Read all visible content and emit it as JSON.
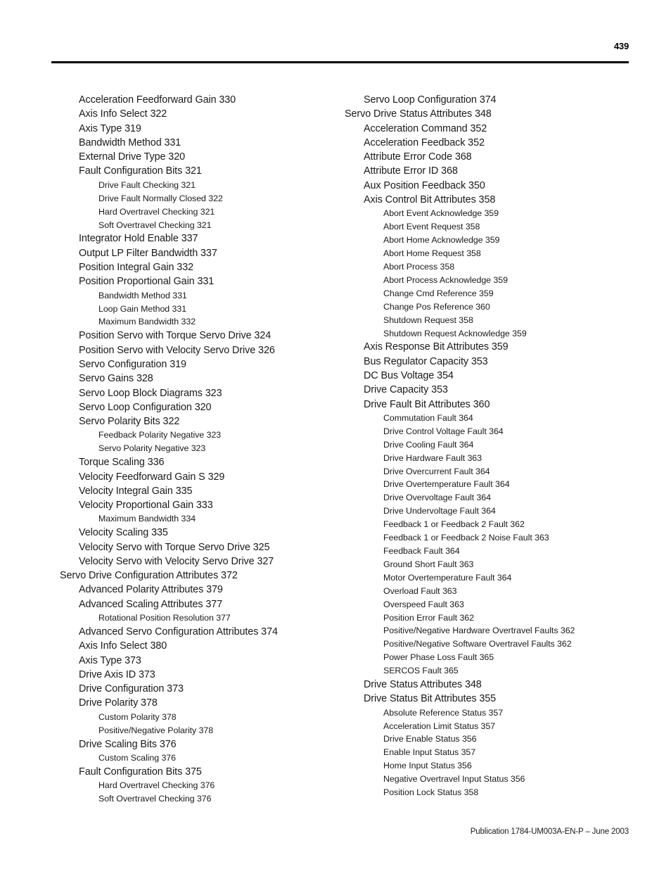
{
  "header": {
    "page_number": "439"
  },
  "footer": {
    "publication": "Publication 1784-UM003A-EN-P – June 2003"
  },
  "index": {
    "left_column": [
      {
        "level": 1,
        "text": "Acceleration Feedforward Gain 330"
      },
      {
        "level": 1,
        "text": "Axis Info Select 322"
      },
      {
        "level": 1,
        "text": "Axis Type 319"
      },
      {
        "level": 1,
        "text": "Bandwidth Method 331"
      },
      {
        "level": 1,
        "text": "External Drive Type 320"
      },
      {
        "level": 1,
        "text": "Fault Configuration Bits 321"
      },
      {
        "level": 2,
        "text": "Drive Fault Checking 321"
      },
      {
        "level": 2,
        "text": "Drive Fault Normally Closed 322"
      },
      {
        "level": 2,
        "text": "Hard Overtravel Checking 321"
      },
      {
        "level": 2,
        "text": "Soft Overtravel Checking 321"
      },
      {
        "level": 1,
        "text": "Integrator Hold Enable 337"
      },
      {
        "level": 1,
        "text": "Output LP Filter Bandwidth 337"
      },
      {
        "level": 1,
        "text": "Position Integral Gain 332"
      },
      {
        "level": 1,
        "text": "Position Proportional Gain 331"
      },
      {
        "level": 2,
        "text": "Bandwidth Method 331"
      },
      {
        "level": 2,
        "text": "Loop Gain Method 331"
      },
      {
        "level": 2,
        "text": "Maximum Bandwidth 332"
      },
      {
        "level": 1,
        "text": "Position Servo with Torque Servo Drive 324"
      },
      {
        "level": 1,
        "text": "Position Servo with Velocity Servo Drive 326"
      },
      {
        "level": 1,
        "text": "Servo Configuration 319"
      },
      {
        "level": 1,
        "text": "Servo Gains 328"
      },
      {
        "level": 1,
        "text": "Servo Loop Block Diagrams 323"
      },
      {
        "level": 1,
        "text": "Servo Loop Configuration 320"
      },
      {
        "level": 1,
        "text": "Servo Polarity Bits 322"
      },
      {
        "level": 2,
        "text": "Feedback Polarity Negative 323"
      },
      {
        "level": 2,
        "text": "Servo Polarity Negative 323"
      },
      {
        "level": 1,
        "text": "Torque Scaling 336"
      },
      {
        "level": 1,
        "text": "Velocity Feedforward Gain S 329"
      },
      {
        "level": 1,
        "text": "Velocity Integral Gain 335"
      },
      {
        "level": 1,
        "text": "Velocity Proportional Gain 333"
      },
      {
        "level": 2,
        "text": "Maximum Bandwidth 334"
      },
      {
        "level": 1,
        "text": "Velocity Scaling 335"
      },
      {
        "level": 1,
        "text": "Velocity Servo with Torque Servo Drive 325"
      },
      {
        "level": 1,
        "text": "Velocity Servo with Velocity Servo Drive 327"
      },
      {
        "level": 0,
        "text": "Servo Drive Configuration Attributes 372"
      },
      {
        "level": 1,
        "text": "Advanced Polarity Attributes 379"
      },
      {
        "level": 1,
        "text": "Advanced Scaling Attributes 377"
      },
      {
        "level": 2,
        "text": "Rotational Position Resolution 377"
      },
      {
        "level": 1,
        "text": "Advanced Servo Configuration Attributes 374"
      },
      {
        "level": 1,
        "text": "Axis Info Select 380"
      },
      {
        "level": 1,
        "text": "Axis Type 373"
      },
      {
        "level": 1,
        "text": "Drive Axis ID 373"
      },
      {
        "level": 1,
        "text": "Drive Configuration 373"
      },
      {
        "level": 1,
        "text": "Drive Polarity 378"
      },
      {
        "level": 2,
        "text": "Custom Polarity 378"
      },
      {
        "level": 2,
        "text": "Positive/Negative Polarity 378"
      },
      {
        "level": 1,
        "text": "Drive Scaling Bits 376"
      },
      {
        "level": 2,
        "text": "Custom Scaling 376"
      },
      {
        "level": 1,
        "text": "Fault Configuration Bits 375"
      },
      {
        "level": 2,
        "text": "Hard Overtravel Checking 376"
      },
      {
        "level": 2,
        "text": "Soft Overtravel Checking 376"
      }
    ],
    "right_column": [
      {
        "level": 1,
        "text": "Servo Loop Configuration 374"
      },
      {
        "level": 0,
        "text": "Servo Drive Status Attributes 348"
      },
      {
        "level": 1,
        "text": "Acceleration Command 352"
      },
      {
        "level": 1,
        "text": "Acceleration Feedback 352"
      },
      {
        "level": 1,
        "text": "Attribute Error Code 368"
      },
      {
        "level": 1,
        "text": "Attribute Error ID 368"
      },
      {
        "level": 1,
        "text": "Aux Position Feedback 350"
      },
      {
        "level": 1,
        "text": "Axis Control Bit Attributes 358"
      },
      {
        "level": 2,
        "text": "Abort Event Acknowledge 359"
      },
      {
        "level": 2,
        "text": "Abort Event Request 358"
      },
      {
        "level": 2,
        "text": "Abort Home Acknowledge 359"
      },
      {
        "level": 2,
        "text": "Abort Home Request 358"
      },
      {
        "level": 2,
        "text": "Abort Process 358"
      },
      {
        "level": 2,
        "text": "Abort Process Acknowledge 359"
      },
      {
        "level": 2,
        "text": "Change Cmd Reference 359"
      },
      {
        "level": 2,
        "text": "Change Pos Reference 360"
      },
      {
        "level": 2,
        "text": "Shutdown Request 358"
      },
      {
        "level": 2,
        "text": "Shutdown Request Acknowledge 359"
      },
      {
        "level": 1,
        "text": "Axis Response Bit Attributes 359"
      },
      {
        "level": 1,
        "text": "Bus Regulator Capacity 353"
      },
      {
        "level": 1,
        "text": "DC Bus Voltage 354"
      },
      {
        "level": 1,
        "text": "Drive Capacity 353"
      },
      {
        "level": 1,
        "text": "Drive Fault Bit Attributes 360"
      },
      {
        "level": 2,
        "text": "Commutation Fault 364"
      },
      {
        "level": 2,
        "text": "Drive Control Voltage Fault 364"
      },
      {
        "level": 2,
        "text": "Drive Cooling Fault 364"
      },
      {
        "level": 2,
        "text": "Drive Hardware Fault 363"
      },
      {
        "level": 2,
        "text": "Drive Overcurrent Fault 364"
      },
      {
        "level": 2,
        "text": "Drive Overtemperature Fault 364"
      },
      {
        "level": 2,
        "text": "Drive Overvoltage Fault 364"
      },
      {
        "level": 2,
        "text": "Drive Undervoltage Fault 364"
      },
      {
        "level": 2,
        "text": "Feedback 1 or Feedback 2 Fault 362"
      },
      {
        "level": 2,
        "text": "Feedback 1 or Feedback 2 Noise Fault 363"
      },
      {
        "level": 2,
        "text": "Feedback Fault 364"
      },
      {
        "level": 2,
        "text": "Ground Short Fault 363"
      },
      {
        "level": 2,
        "text": "Motor Overtemperature Fault 364"
      },
      {
        "level": 2,
        "text": "Overload Fault 363"
      },
      {
        "level": 2,
        "text": "Overspeed Fault 363"
      },
      {
        "level": 2,
        "text": "Position Error Fault 362"
      },
      {
        "level": 2,
        "text": "Positive/Negative Hardware Overtravel Faults 362"
      },
      {
        "level": 2,
        "text": "Positive/Negative Software Overtravel Faults 362"
      },
      {
        "level": 2,
        "text": "Power Phase Loss Fault 365"
      },
      {
        "level": 2,
        "text": "SERCOS Fault 365"
      },
      {
        "level": 1,
        "text": "Drive Status Attributes 348"
      },
      {
        "level": 1,
        "text": "Drive Status Bit Attributes 355"
      },
      {
        "level": 2,
        "text": "Absolute Reference Status 357"
      },
      {
        "level": 2,
        "text": "Acceleration Limit Status 357"
      },
      {
        "level": 2,
        "text": "Drive Enable Status 356"
      },
      {
        "level": 2,
        "text": "Enable Input Status 357"
      },
      {
        "level": 2,
        "text": "Home Input Status 356"
      },
      {
        "level": 2,
        "text": "Negative Overtravel Input Status 356"
      },
      {
        "level": 2,
        "text": "Position Lock Status 358"
      }
    ]
  }
}
